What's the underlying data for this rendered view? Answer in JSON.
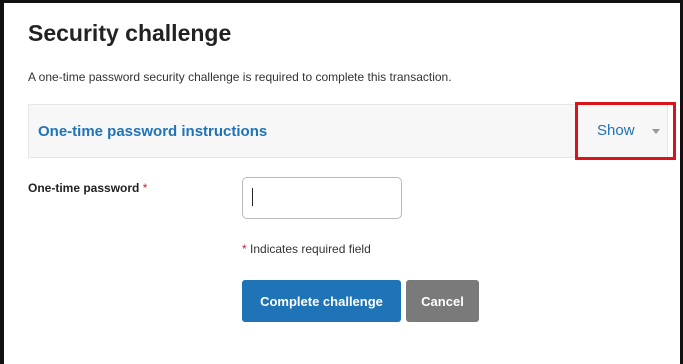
{
  "page": {
    "title": "Security challenge",
    "subtitle": "A one-time password security challenge is required to complete this transaction."
  },
  "instructions_panel": {
    "title": "One-time password instructions",
    "toggle_label": "Show",
    "toggle_icon": "chevron-down-icon",
    "highlight_color": "#d8141a"
  },
  "form": {
    "otp_label": "One-time password",
    "required_marker": "*",
    "otp_value": "",
    "required_note": "Indicates required field"
  },
  "buttons": {
    "primary_label": "Complete challenge",
    "secondary_label": "Cancel"
  },
  "colors": {
    "accent": "#1f73b7",
    "secondary_button": "#7a7a7a",
    "required": "#d21f2b"
  }
}
